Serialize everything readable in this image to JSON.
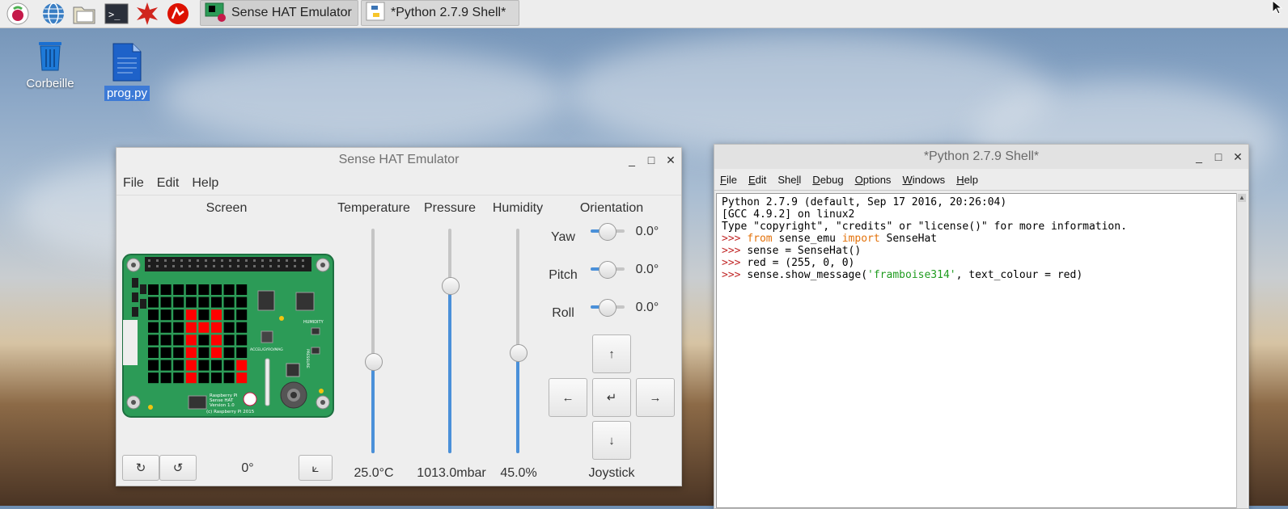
{
  "taskbar": {
    "tasks": [
      {
        "label": "Sense HAT Emulator"
      },
      {
        "label": "*Python 2.7.9 Shell*"
      }
    ]
  },
  "desktop": {
    "icons": [
      {
        "label": "Corbeille"
      },
      {
        "label": "prog.py"
      }
    ]
  },
  "sensehat": {
    "title": "Sense HAT Emulator",
    "menu": [
      "File",
      "Edit",
      "Help"
    ],
    "screen_label": "Screen",
    "rotation_value": "0°",
    "temperature": {
      "label": "Temperature",
      "value": "25.0°C",
      "fraction": 0.41
    },
    "pressure": {
      "label": "Pressure",
      "value": "1013.0mbar",
      "fraction": 0.75
    },
    "humidity": {
      "label": "Humidity",
      "value": "45.0%",
      "fraction": 0.45
    },
    "orientation": {
      "label": "Orientation",
      "rows": [
        {
          "label": "Yaw",
          "value": "0.0°"
        },
        {
          "label": "Pitch",
          "value": "0.0°"
        },
        {
          "label": "Roll",
          "value": "0.0°"
        }
      ]
    },
    "joystick": {
      "label": "Joystick",
      "up": "↑",
      "down": "↓",
      "left": "←",
      "right": "→",
      "enter": "↵"
    },
    "board_text": {
      "humidity": "HUMIDITY",
      "accel": "ACCEL/GYRO/MAG",
      "pressure": "PRESSURE",
      "brand": "Raspberry Pi",
      "product": "Sense HAT",
      "version": "Version 1.0",
      "copyright": "(c) Raspberry Pi 2015"
    },
    "led_red": [
      "........",
      "........",
      "...#.#..",
      "...###..",
      "...#.#..",
      "...#.#..",
      "...#...#",
      "...#...#"
    ],
    "colors": {
      "led_on": "#ff0000",
      "led_off": "#000000",
      "pcb": "#2c9b57"
    }
  },
  "shell": {
    "title": "*Python 2.7.9 Shell*",
    "menu": [
      {
        "pre": "",
        "u": "F",
        "post": "ile"
      },
      {
        "pre": "",
        "u": "E",
        "post": "dit"
      },
      {
        "pre": "She",
        "u": "l",
        "post": "l"
      },
      {
        "pre": "",
        "u": "D",
        "post": "ebug"
      },
      {
        "pre": "",
        "u": "O",
        "post": "ptions"
      },
      {
        "pre": "",
        "u": "W",
        "post": "indows"
      },
      {
        "pre": "",
        "u": "H",
        "post": "elp"
      }
    ],
    "lines": [
      [
        {
          "t": "Python 2.7.9 (default, Sep 17 2016, 20:26:04)",
          "c": ""
        }
      ],
      [
        {
          "t": "[GCC 4.9.2] on linux2",
          "c": ""
        }
      ],
      [
        {
          "t": "Type \"copyright\", \"credits\" or \"license()\" for more information.",
          "c": ""
        }
      ],
      [
        {
          "t": ">>> ",
          "c": "prompt"
        },
        {
          "t": "from",
          "c": "kw"
        },
        {
          "t": " sense_emu ",
          "c": ""
        },
        {
          "t": "import",
          "c": "kw"
        },
        {
          "t": " SenseHat",
          "c": ""
        }
      ],
      [
        {
          "t": ">>> ",
          "c": "prompt"
        },
        {
          "t": "sense = SenseHat()",
          "c": ""
        }
      ],
      [
        {
          "t": ">>> ",
          "c": "prompt"
        },
        {
          "t": "red = (255, 0, 0)",
          "c": ""
        }
      ],
      [
        {
          "t": ">>> ",
          "c": "prompt"
        },
        {
          "t": "sense.show_message(",
          "c": ""
        },
        {
          "t": "'framboise314'",
          "c": "str"
        },
        {
          "t": ", text_colour = red)",
          "c": ""
        }
      ]
    ]
  }
}
